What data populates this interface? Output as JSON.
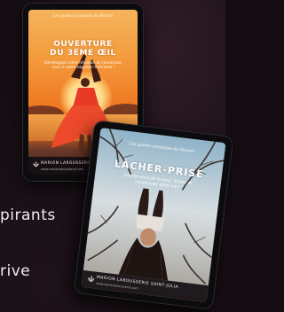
{
  "background_color": "#150d12",
  "side_text": {
    "line1": "pirants",
    "line2": "rive"
  },
  "ebook1": {
    "tagline": "Les guides pratiques de Marion",
    "title_line1": "OUVERTURE",
    "title_line2": "DU 3ÈME ŒIL",
    "subtitle": "Développez votre intuition et connectez-vous à votre sagesse intérieure !",
    "author": "MARION LAROUSSERIE SAINT-",
    "website": "www.marionlarousserie.com",
    "accent_color": "#f07c25"
  },
  "ebook2": {
    "tagline": "Les guides pratiques de Marion",
    "title": "LÂCHER-PRISE",
    "subtitle": "Libérez-vous de la peur, lâchez et construisez votre vie !",
    "author": "MARION LAROUSSERIE SAINT-JULIA",
    "website": "www.marionlarousserie.com",
    "accent_color": "#b9ccd6"
  }
}
